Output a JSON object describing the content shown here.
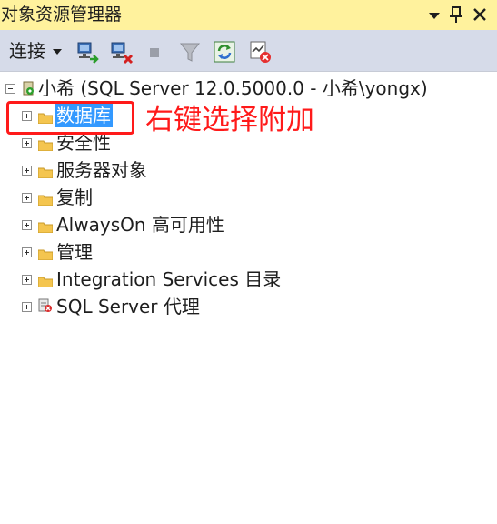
{
  "window": {
    "title": "对象资源管理器",
    "pin_icon": "pin-icon",
    "dropdown_icon": "dropdown-arrow-icon",
    "close_icon": "close-icon"
  },
  "toolbar": {
    "connect_label": "连接",
    "icons": [
      "connect-object-explorer-icon",
      "disconnect-icon",
      "stop-icon",
      "filter-icon",
      "refresh-icon",
      "activity-monitor-icon"
    ]
  },
  "tree": {
    "server": "小希 (SQL Server 12.0.5000.0 - 小希\\yongx)",
    "nodes": [
      {
        "label": "数据库",
        "selected": true
      },
      {
        "label": "安全性"
      },
      {
        "label": "服务器对象"
      },
      {
        "label": "复制"
      },
      {
        "label": "AlwaysOn 高可用性"
      },
      {
        "label": "管理"
      },
      {
        "label": "Integration Services 目录"
      },
      {
        "label": "SQL Server 代理"
      }
    ]
  },
  "annotation": {
    "text": "右键选择附加",
    "color": "#ff1a1a"
  },
  "colors": {
    "titlebar": "#fff29d",
    "toolbar": "#d6dbe9",
    "selection": "#3399ff"
  }
}
